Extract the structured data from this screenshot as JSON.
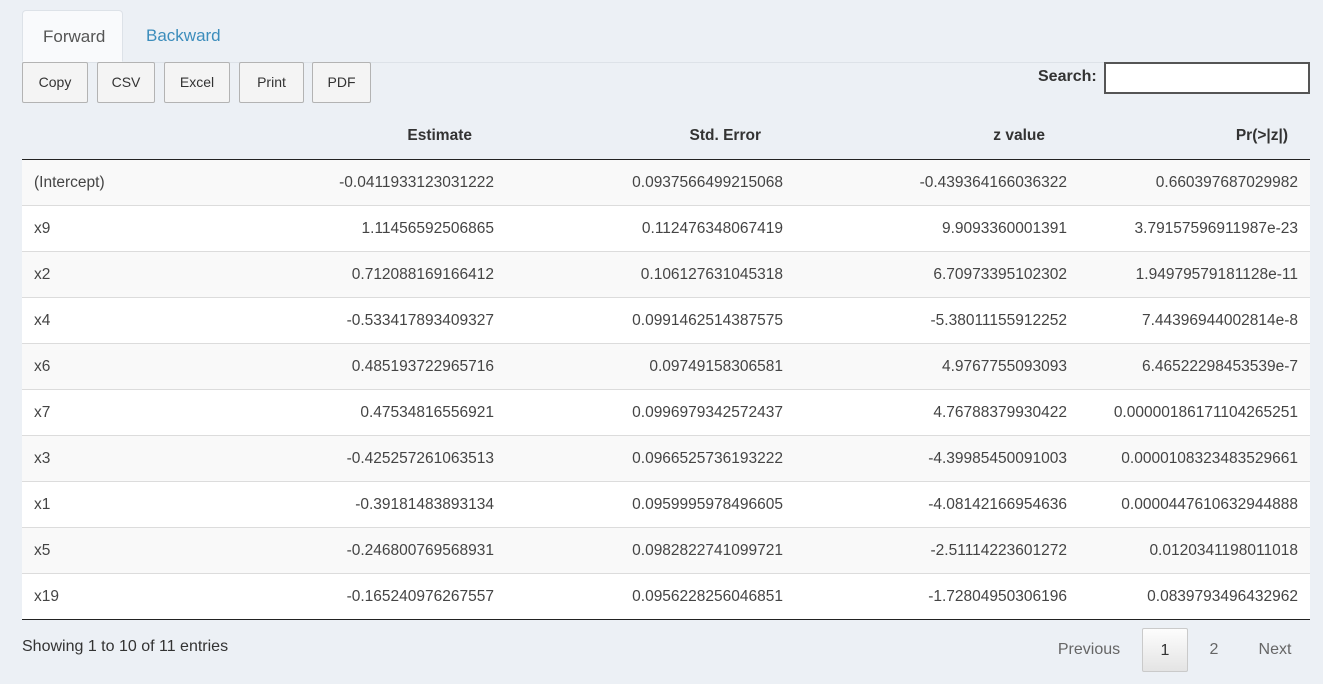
{
  "tabs": [
    {
      "label": "Forward",
      "active": true
    },
    {
      "label": "Backward",
      "active": false
    }
  ],
  "buttons": [
    "Copy",
    "CSV",
    "Excel",
    "Print",
    "PDF"
  ],
  "search": {
    "label": "Search:",
    "value": ""
  },
  "table": {
    "columns": [
      "",
      "Estimate",
      "Std. Error",
      "z value",
      "Pr(>|z|)"
    ],
    "rows": [
      [
        "(Intercept)",
        "-0.0411933123031222",
        "0.0937566499215068",
        "-0.439364166036322",
        "0.660397687029982"
      ],
      [
        "x9",
        "1.11456592506865",
        "0.112476348067419",
        "9.9093360001391",
        "3.79157596911987e-23"
      ],
      [
        "x2",
        "0.712088169166412",
        "0.106127631045318",
        "6.70973395102302",
        "1.94979579181128e-11"
      ],
      [
        "x4",
        "-0.533417893409327",
        "0.0991462514387575",
        "-5.38011155912252",
        "7.44396944002814e-8"
      ],
      [
        "x6",
        "0.485193722965716",
        "0.09749158306581",
        "4.9767755093093",
        "6.46522298453539e-7"
      ],
      [
        "x7",
        "0.47534816556921",
        "0.0996979342572437",
        "4.76788379930422",
        "0.00000186171104265251"
      ],
      [
        "x3",
        "-0.425257261063513",
        "0.0966525736193222",
        "-4.39985450091003",
        "0.0000108323483529661"
      ],
      [
        "x1",
        "-0.39181483893134",
        "0.0959995978496605",
        "-4.08142166954636",
        "0.0000447610632944888"
      ],
      [
        "x5",
        "-0.246800769568931",
        "0.0982822741099721",
        "-2.51114223601272",
        "0.0120341198011018"
      ],
      [
        "x19",
        "-0.165240976267557",
        "0.0956228256046851",
        "-1.72804950306196",
        "0.0839793496432962"
      ]
    ]
  },
  "info": "Showing 1 to 10 of 11 entries",
  "pagination": {
    "previous": "Previous",
    "pages": [
      "1",
      "2"
    ],
    "current": "1",
    "next": "Next"
  }
}
